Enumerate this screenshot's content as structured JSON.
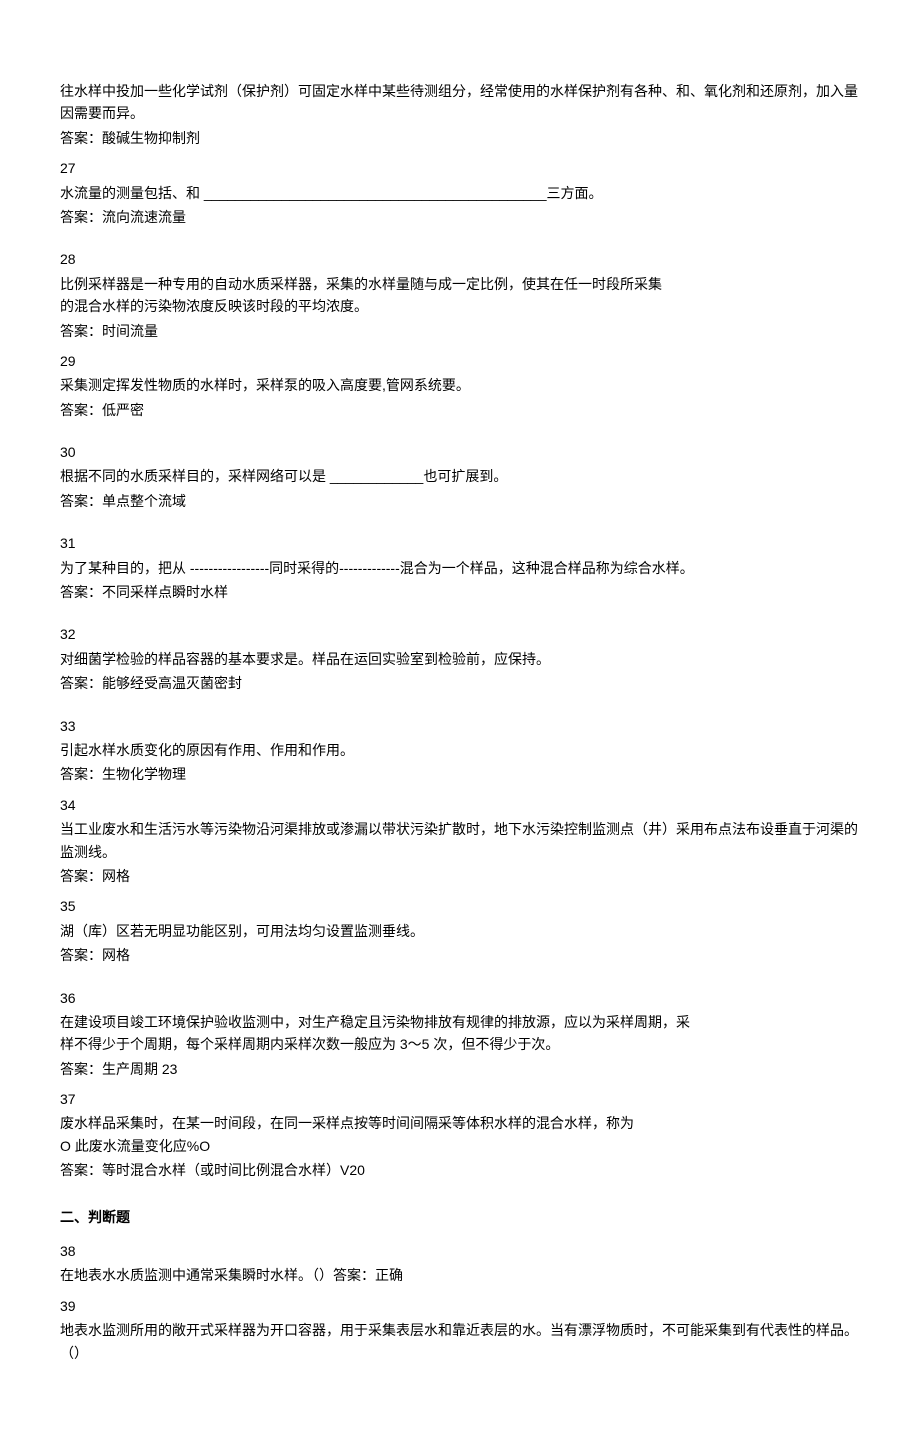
{
  "items": [
    {
      "num": "",
      "question": "往水样中投加一些化学试剂（保护剂）可固定水样中某些待测组分，经常使用的水样保护剂有各种、和、氧化剂和还原剂，加入量因需要而异。",
      "answer": "答案：酸碱生物抑制剂"
    },
    {
      "num": "27",
      "question": "水流量的测量包括、和 ____________________________________________三方面。",
      "answer": "答案：流向流速流量"
    },
    {
      "num": "28",
      "gapTop": true,
      "question": "比例采样器是一种专用的自动水质采样器，采集的水样量随与成一定比例，使其在任一时段所采集\n的混合水样的污染物浓度反映该时段的平均浓度。",
      "answer": "答案：时间流量"
    },
    {
      "num": "29",
      "question": "采集测定挥发性物质的水样时，采样泵的吸入高度要,管网系统要。",
      "answer": "答案：低严密"
    },
    {
      "num": "30",
      "gapTop": true,
      "question": "根据不同的水质采样目的，采样网络可以是 ____________也可扩展到。",
      "answer": "答案：单点整个流域"
    },
    {
      "num": "31",
      "gapTop": true,
      "question": "为了某种目的，把从 -----------------同时采得的-------------混合为一个样品，这种混合样品称为综合水样。",
      "answer": "答案：不同采样点瞬时水样"
    },
    {
      "num": "32",
      "gapTop": true,
      "question": "对细菌学检验的样品容器的基本要求是。样品在运回实验室到检验前，应保持。",
      "answer": "答案：能够经受高温灭菌密封"
    },
    {
      "num": "33",
      "gapTop": true,
      "question": "引起水样水质变化的原因有作用、作用和作用。",
      "answer": "答案：生物化学物理"
    },
    {
      "num": "34",
      "question": "当工业废水和生活污水等污染物沿河渠排放或渗漏以带状污染扩散时，地下水污染控制监测点（井）采用布点法布设垂直于河渠的监测线。",
      "answer": "答案：网格"
    },
    {
      "num": "35",
      "question": "湖（库）区若无明显功能区别，可用法均匀设置监测垂线。",
      "answer": "答案：网格"
    },
    {
      "num": "36",
      "gapTop": true,
      "question": "在建设项目竣工环境保护验收监测中，对生产稳定且污染物排放有规律的排放源，应以为采样周期，采\n样不得少于个周期，每个采样周期内采样次数一般应为 3～5 次，但不得少于次。",
      "answer": "答案：生产周期 23"
    },
    {
      "num": "37",
      "question": "废水样品采集时，在某一时间段，在同一采样点按等时间间隔采等体积水样的混合水样，称为\nO 此废水流量变化应%O",
      "answer": "答案：等时混合水样（或时间比例混合水样）V20"
    }
  ],
  "section2": {
    "title": "二、判断题",
    "items": [
      {
        "num": "38",
        "question": "在地表水水质监测中通常采集瞬时水样。（）答案：正确"
      },
      {
        "num": "39",
        "question": "地表水监测所用的敞开式采样器为开口容器，用于采集表层水和靠近表层的水。当有漂浮物质时，不可能采集到有代表性的样品。（）"
      }
    ]
  }
}
